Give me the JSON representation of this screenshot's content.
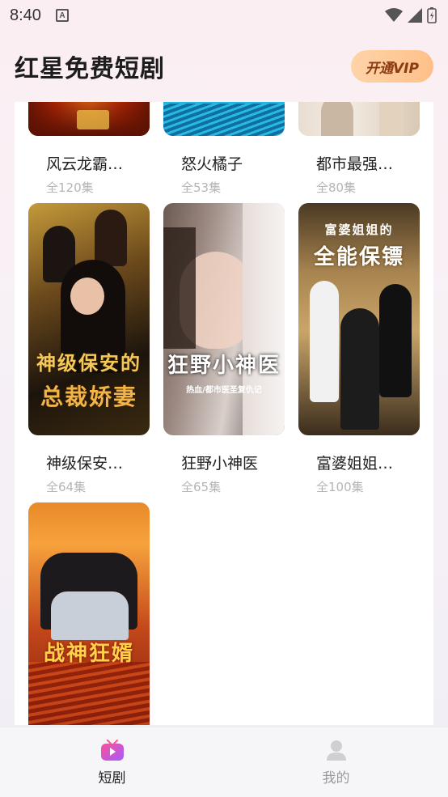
{
  "status_bar": {
    "time": "8:40",
    "notification_icon": "A"
  },
  "header": {
    "title": "红星免费短剧",
    "vip_label": "开通VIP"
  },
  "dramas": [
    {
      "title": "风云龙霸…",
      "episodes": "全120集"
    },
    {
      "title": "怒火橘子",
      "episodes": "全53集"
    },
    {
      "title": "都市最强…",
      "episodes": "全80集"
    },
    {
      "title": "神级保安…",
      "episodes": "全64集",
      "poster_text_1": "神级保安的",
      "poster_text_2": "总裁娇妻"
    },
    {
      "title": "狂野小神医",
      "episodes": "全65集",
      "poster_text_1": "狂野小神医",
      "poster_text_2": "热血/都市医圣复仇记"
    },
    {
      "title": "富婆姐姐…",
      "episodes": "全100集",
      "poster_text_1": "富婆姐姐的",
      "poster_text_2": "全能保镖"
    },
    {
      "poster_text_1": "战神狂婿"
    }
  ],
  "tabs": [
    {
      "label": "短剧",
      "icon": "tv-play-icon",
      "active": true
    },
    {
      "label": "我的",
      "icon": "user-icon",
      "active": false
    }
  ]
}
